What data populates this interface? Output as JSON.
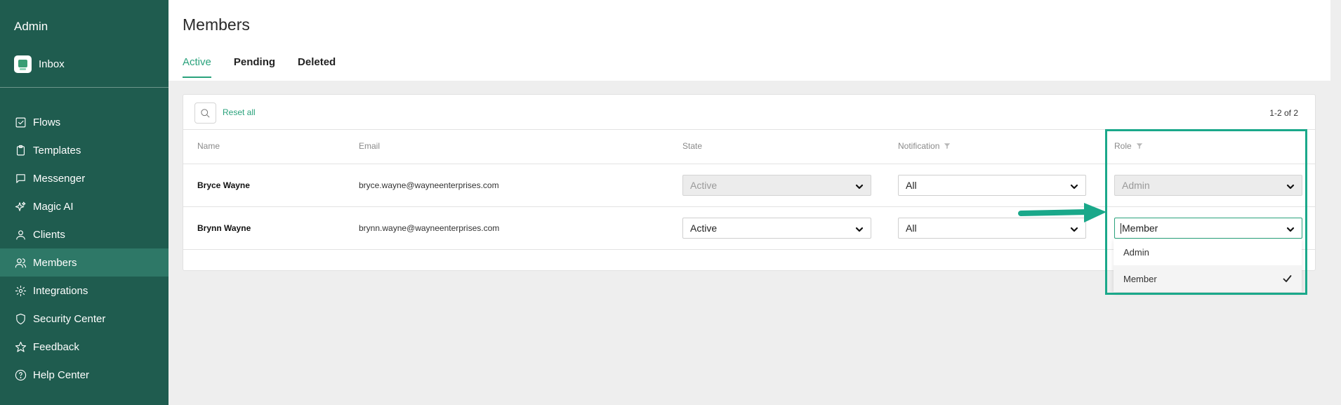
{
  "sidebar": {
    "title": "Admin",
    "inbox_label": "Inbox",
    "items": [
      {
        "label": "Flows",
        "icon": "checkbox-icon"
      },
      {
        "label": "Templates",
        "icon": "clipboard-icon"
      },
      {
        "label": "Messenger",
        "icon": "chat-icon"
      },
      {
        "label": "Magic AI",
        "icon": "sparkles-icon"
      },
      {
        "label": "Clients",
        "icon": "user-icon"
      },
      {
        "label": "Members",
        "icon": "users-icon",
        "active": true
      },
      {
        "label": "Integrations",
        "icon": "gear-icon"
      },
      {
        "label": "Security Center",
        "icon": "shield-icon"
      },
      {
        "label": "Feedback",
        "icon": "star-icon"
      },
      {
        "label": "Help Center",
        "icon": "help-circle-icon"
      }
    ]
  },
  "header": {
    "title": "Members",
    "tabs": [
      {
        "label": "Active",
        "active": true
      },
      {
        "label": "Pending"
      },
      {
        "label": "Deleted"
      }
    ]
  },
  "toolbar": {
    "reset_label": "Reset all",
    "pagination": "1-2 of 2"
  },
  "table": {
    "columns": [
      "Name",
      "Email",
      "State",
      "Notification",
      "Role"
    ],
    "rows": [
      {
        "name": "Bryce Wayne",
        "email": "bryce.wayne@wayneenterprises.com",
        "state": "Active",
        "notification": "All",
        "role": "Admin",
        "state_disabled": true,
        "role_disabled": true
      },
      {
        "name": "Brynn Wayne",
        "email": "brynn.wayne@wayneenterprises.com",
        "state": "Active",
        "notification": "All",
        "role": "Member"
      }
    ]
  },
  "role_dropdown": {
    "options": [
      "Admin",
      "Member"
    ],
    "selected": "Member"
  },
  "colors": {
    "sidebar_bg": "#1f5c4f",
    "sidebar_active": "#2e7867",
    "accent": "#2aa27c",
    "annotation": "#1aa88a"
  }
}
